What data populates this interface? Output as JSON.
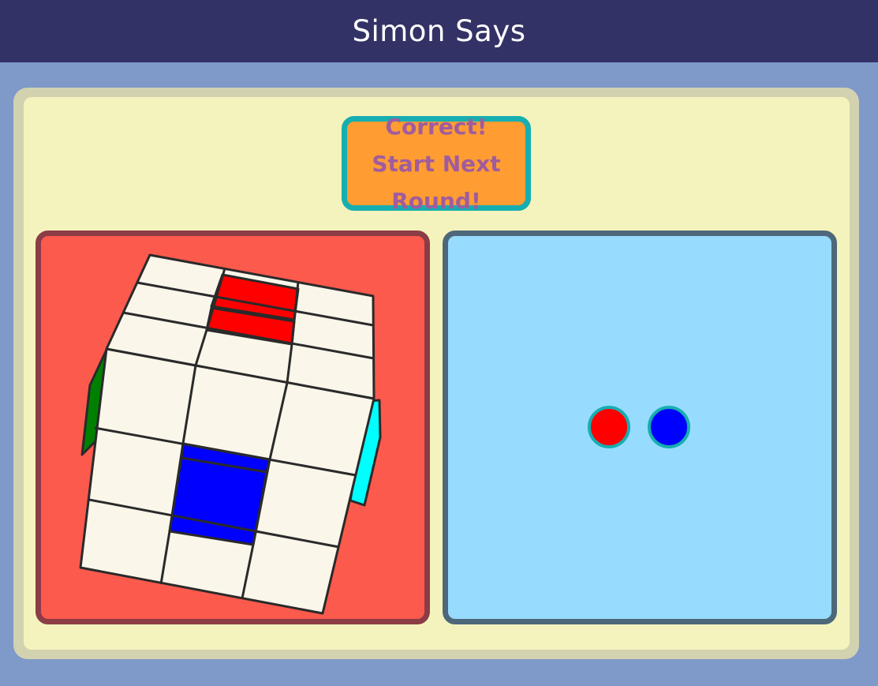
{
  "header": {
    "title": "Simon Says"
  },
  "next_round_button": {
    "label": "Correct! Start Next Round!"
  },
  "colors": {
    "header_bg": "#323266",
    "page_bg": "#7f99c9",
    "panel_bg": "#f5f3bd",
    "button_bg": "#ff9c32",
    "button_border": "#16aeb0",
    "button_text": "#a05c9e",
    "cube_panel_bg": "#fc5a4d",
    "sequence_panel_bg": "#97dbfe",
    "sticker_base": "#faf6ea"
  },
  "cube": {
    "highlighted_stickers": [
      {
        "face": "top",
        "color": "red"
      },
      {
        "face": "front",
        "color": "blue"
      }
    ],
    "side_colors": [
      "green",
      "cyan"
    ]
  },
  "sequence": {
    "dots": [
      {
        "name": "red",
        "color": "#ff0000"
      },
      {
        "name": "blue",
        "color": "#0000ff"
      }
    ]
  }
}
